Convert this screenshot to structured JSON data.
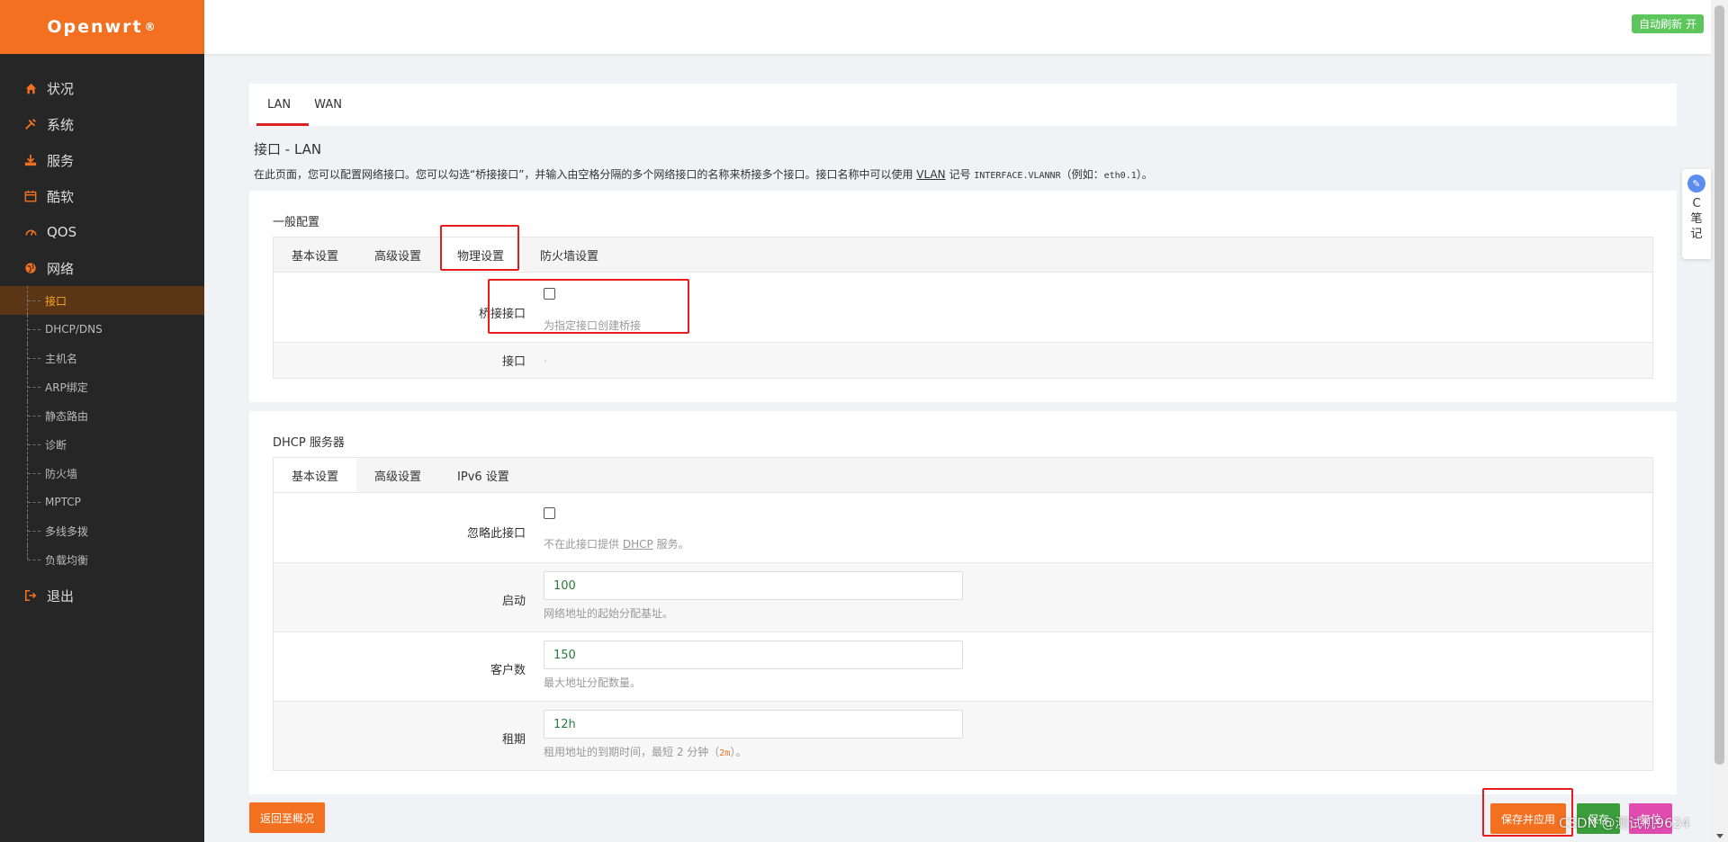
{
  "brand": {
    "name": "Openwrt",
    "mark": "®"
  },
  "header": {
    "autorefresh_label": "自动刷新 开"
  },
  "sidebar": {
    "items": [
      {
        "label": "状况",
        "icon": "home-icon"
      },
      {
        "label": "系统",
        "icon": "tools-icon"
      },
      {
        "label": "服务",
        "icon": "download-icon"
      },
      {
        "label": "酷软",
        "icon": "calendar-icon"
      },
      {
        "label": "QOS",
        "icon": "gauge-icon"
      },
      {
        "label": "网络",
        "icon": "globe-icon"
      }
    ],
    "network_sub": [
      "接口",
      "DHCP/DNS",
      "主机名",
      "ARP绑定",
      "静态路由",
      "诊断",
      "防火墙",
      "MPTCP",
      "多线多拨",
      "负载均衡"
    ],
    "logout_label": "退出"
  },
  "notes_widget": {
    "letter": "C",
    "line1": "笔",
    "line2": "记"
  },
  "top_tabs": [
    "LAN",
    "WAN"
  ],
  "page": {
    "title": "接口 - LAN",
    "desc_before": "在此页面，您可以配置网络接口。您可以勾选“桥接接口”，并输入由空格分隔的多个网络接口的名称来桥接多个接口。接口名称中可以使用 ",
    "desc_vlan": "VLAN",
    "desc_mid": " 记号 ",
    "desc_code": "INTERFACE.VLANNR",
    "desc_example_pre": "（例如：",
    "desc_example_code": "eth0.1",
    "desc_example_post": "）。"
  },
  "general": {
    "title": "一般配置",
    "tabs": [
      "基本设置",
      "高级设置",
      "物理设置",
      "防火墙设置"
    ],
    "bridge_label": "桥接接口",
    "bridge_hint": "为指定接口创建桥接",
    "iface_label": "接口",
    "iface_value": "."
  },
  "dhcp": {
    "title": "DHCP 服务器",
    "tabs": [
      "基本设置",
      "高级设置",
      "IPv6 设置"
    ],
    "ignore_label": "忽略此接口",
    "ignore_hint_pre": "不在此接口提供 ",
    "ignore_hint_link": "DHCP",
    "ignore_hint_post": " 服务。",
    "start_label": "启动",
    "start_value": "100",
    "start_hint": "网络地址的起始分配基址。",
    "limit_label": "客户数",
    "limit_value": "150",
    "limit_hint": "最大地址分配数量。",
    "lease_label": "租期",
    "lease_value": "12h",
    "lease_hint_pre": "租用地址的到期时间，最短 2 分钟（",
    "lease_hint_code": "2m",
    "lease_hint_post": "）。"
  },
  "actions": {
    "back": "返回至概况",
    "save_apply": "保存并应用",
    "save": "保存",
    "reset": "复位"
  },
  "watermark": "CSDN @测试机9624",
  "colors": {
    "accent": "#f37021",
    "sidebar_bg": "#262626",
    "highlight": "#e81c1c",
    "save": "#3a9c3a",
    "reset": "#e04bb0"
  }
}
